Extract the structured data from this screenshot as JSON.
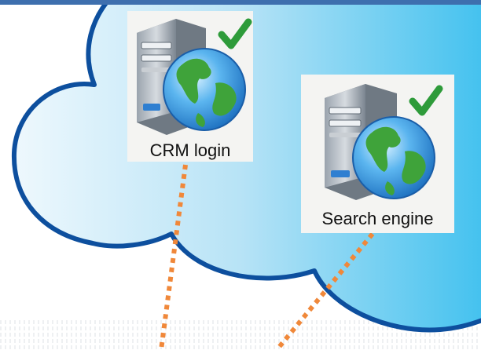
{
  "diagram": {
    "nodes": [
      {
        "id": "crm",
        "label": "CRM login",
        "icon": "web-server-globe-icon",
        "status": "ok"
      },
      {
        "id": "search",
        "label": "Search engine",
        "icon": "web-server-globe-icon",
        "status": "ok"
      }
    ],
    "connectors": [
      {
        "from": "crm",
        "style": "dotted",
        "color": "#f0883a"
      },
      {
        "from": "search",
        "style": "dotted",
        "color": "#f0883a"
      }
    ],
    "colors": {
      "cloud_fill_light": "#eaf6fc",
      "cloud_fill_dark": "#3bc2ee",
      "cloud_outline": "#0d4f9e",
      "top_band": "#3e6fae",
      "connector": "#f0883a",
      "check": "#2e9b3a"
    }
  }
}
